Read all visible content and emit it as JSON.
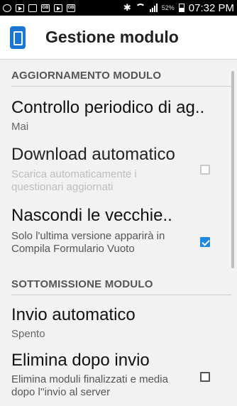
{
  "statusbar": {
    "battery": "52%",
    "time": "07:32 PM"
  },
  "actionbar": {
    "title": "Gestione modulo"
  },
  "sections": [
    {
      "header": "AGGIORNAMENTO MODULO"
    },
    {
      "header": "SOTTOMISSIONE MODULO"
    }
  ],
  "prefs": [
    {
      "title": "Controllo periodico di ag..",
      "summary": "Mai"
    },
    {
      "title": "Download automatico",
      "summary": "Scarica automaticamente i questionari aggiornati",
      "checked": false,
      "enabled": false
    },
    {
      "title": "Nascondi le vecchie..",
      "summary": "Solo l'ultima versione apparirà in Compila Formulario Vuoto",
      "checked": true,
      "enabled": true
    },
    {
      "title": "Invio automatico",
      "summary": "Spento"
    },
    {
      "title": "Elimina dopo invio",
      "summary": "Elimina moduli finalizzati e media dopo l''invio al server",
      "checked": false,
      "enabled": true
    }
  ],
  "colors": {
    "accent": "#1e88e5",
    "app_icon": "#1976d2"
  }
}
